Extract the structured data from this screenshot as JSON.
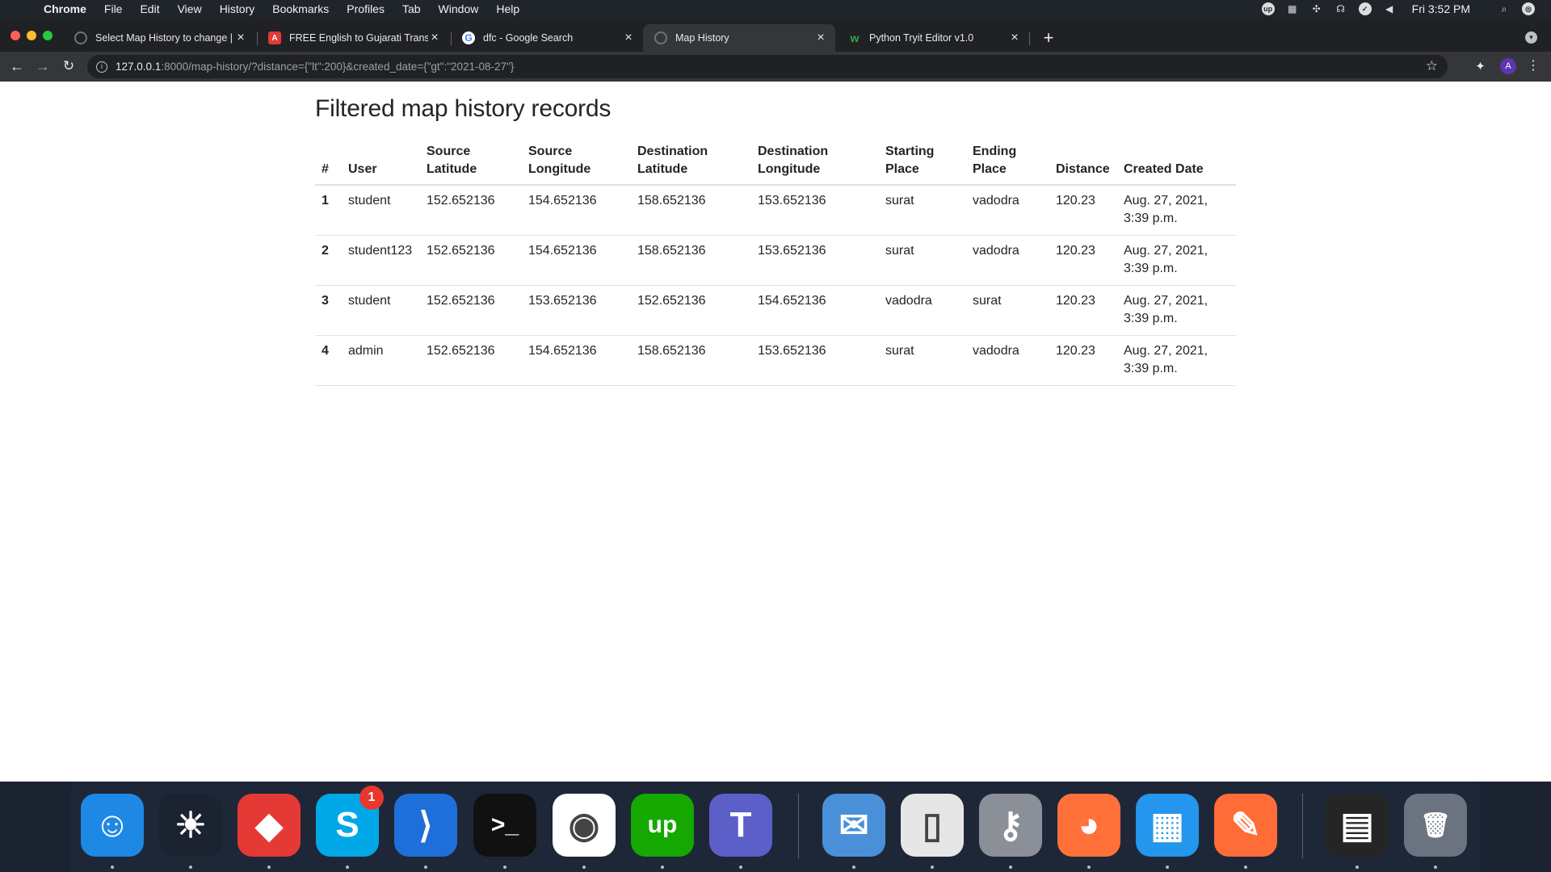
{
  "menubar": {
    "apple": "",
    "items": [
      "Chrome",
      "File",
      "Edit",
      "View",
      "History",
      "Bookmarks",
      "Profiles",
      "Tab",
      "Window",
      "Help"
    ],
    "tray_icons": [
      "upwork-tray-icon",
      "docker-tray-icon",
      "network-tray-icon",
      "ghostery-tray-icon",
      "check-tray-icon",
      "volume-tray-icon"
    ],
    "clock": "Fri 3:52 PM"
  },
  "tabs": [
    {
      "title": "Select Map History to change | Django site admin",
      "icon": "globe-icon"
    },
    {
      "title": "FREE English to Gujarati Translation",
      "icon": "translate-icon"
    },
    {
      "title": "dfc - Google Search",
      "icon": "google-icon"
    },
    {
      "title": "Map History",
      "icon": "globe-icon",
      "active": true
    },
    {
      "title": "Python Tryit Editor v1.0",
      "icon": "w3schools-icon"
    }
  ],
  "toolbar": {
    "url_host": "127.0.0.1",
    "url_rest": ":8000/map-history/?distance={\"lt\":200}&created_date={\"gt\":\"2021-08-27\"}",
    "profile_initial": "A"
  },
  "page": {
    "heading": "Filtered map history records",
    "columns": [
      "#",
      "User",
      "Source Latitude",
      "Source Longitude",
      "Destination Latitude",
      "Destination Longitude",
      "Starting Place",
      "Ending Place",
      "Distance",
      "Created Date"
    ],
    "rows": [
      [
        "1",
        "student",
        "152.652136",
        "154.652136",
        "158.652136",
        "153.652136",
        "surat",
        "vadodra",
        "120.23",
        "Aug. 27, 2021, 3:39 p.m."
      ],
      [
        "2",
        "student123",
        "152.652136",
        "154.652136",
        "158.652136",
        "153.652136",
        "surat",
        "vadodra",
        "120.23",
        "Aug. 27, 2021, 3:39 p.m."
      ],
      [
        "3",
        "student",
        "152.652136",
        "153.652136",
        "152.652136",
        "154.652136",
        "vadodra",
        "surat",
        "120.23",
        "Aug. 27, 2021, 3:39 p.m."
      ],
      [
        "4",
        "admin",
        "152.652136",
        "154.652136",
        "158.652136",
        "153.652136",
        "surat",
        "vadodra",
        "120.23",
        "Aug. 27, 2021, 3:39 p.m."
      ]
    ]
  },
  "dock": {
    "apps": [
      {
        "name": "finder",
        "glyph": "☺",
        "color": "#1e88e5"
      },
      {
        "name": "sunflower",
        "glyph": "☀",
        "color": "#1b2230"
      },
      {
        "name": "anydesk",
        "glyph": "◆",
        "color": "#e53935"
      },
      {
        "name": "skype",
        "glyph": "S",
        "color": "#00a8e8",
        "badge": "1"
      },
      {
        "name": "vscode",
        "glyph": "⟩",
        "color": "#1e6fd9"
      },
      {
        "name": "terminal",
        "glyph": ">_",
        "color": "#111111"
      },
      {
        "name": "chrome",
        "glyph": "◉",
        "color": "#ffffff"
      },
      {
        "name": "upwork",
        "glyph": "up",
        "color": "#14a800"
      },
      {
        "name": "teams",
        "glyph": "T",
        "color": "#5b5fc7"
      },
      {
        "name": "mail",
        "glyph": "✉",
        "color": "#4a90d9"
      },
      {
        "name": "libreoffice",
        "glyph": "▯",
        "color": "#e6e6e6"
      },
      {
        "name": "keychain",
        "glyph": "⚷",
        "color": "#8a8f98"
      },
      {
        "name": "firefox",
        "glyph": "◕",
        "color": "#ff7139"
      },
      {
        "name": "docker",
        "glyph": "▦",
        "color": "#2496ed"
      },
      {
        "name": "postman",
        "glyph": "✎",
        "color": "#ff6c37"
      },
      {
        "name": "vscode-window",
        "glyph": "▤",
        "color": "#252526"
      },
      {
        "name": "trash",
        "glyph": "🗑",
        "color": "#6b7280"
      }
    ]
  }
}
